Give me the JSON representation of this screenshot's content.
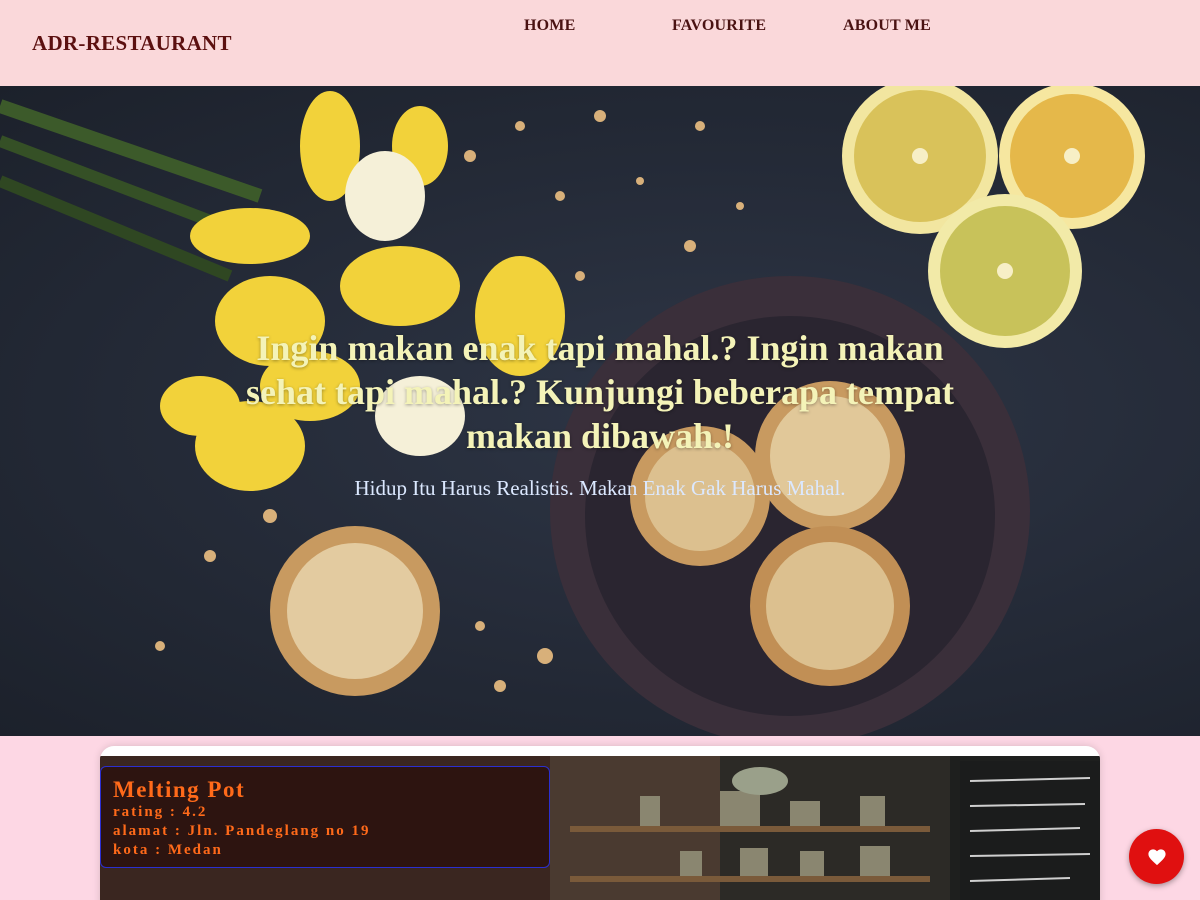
{
  "header": {
    "brand": "ADR-RESTAURANT",
    "nav": [
      "HOME",
      "FAVOURITE",
      "ABOUT ME"
    ]
  },
  "hero": {
    "title": "Ingin makan enak tapi mahal.? Ingin makan sehat tapi mahal.? Kunjungi beberapa tempat makan dibawah.!",
    "subtitle": "Hidup Itu Harus Realistis. Makan Enak Gak Harus Mahal."
  },
  "restaurants": [
    {
      "name": "Melting Pot",
      "rating_line": "rating : 4.2",
      "address_line": "alamat : Jln. Pandeglang no 19",
      "city_line": "kota : Medan"
    }
  ],
  "favorite_button": {
    "icon": "heart-icon"
  },
  "colors": {
    "header_bg": "#fad8da",
    "page_bg": "#fdd7e4",
    "hero_title": "#f4f3b8",
    "card_text": "#ff6a1a",
    "fab": "#e01010"
  }
}
